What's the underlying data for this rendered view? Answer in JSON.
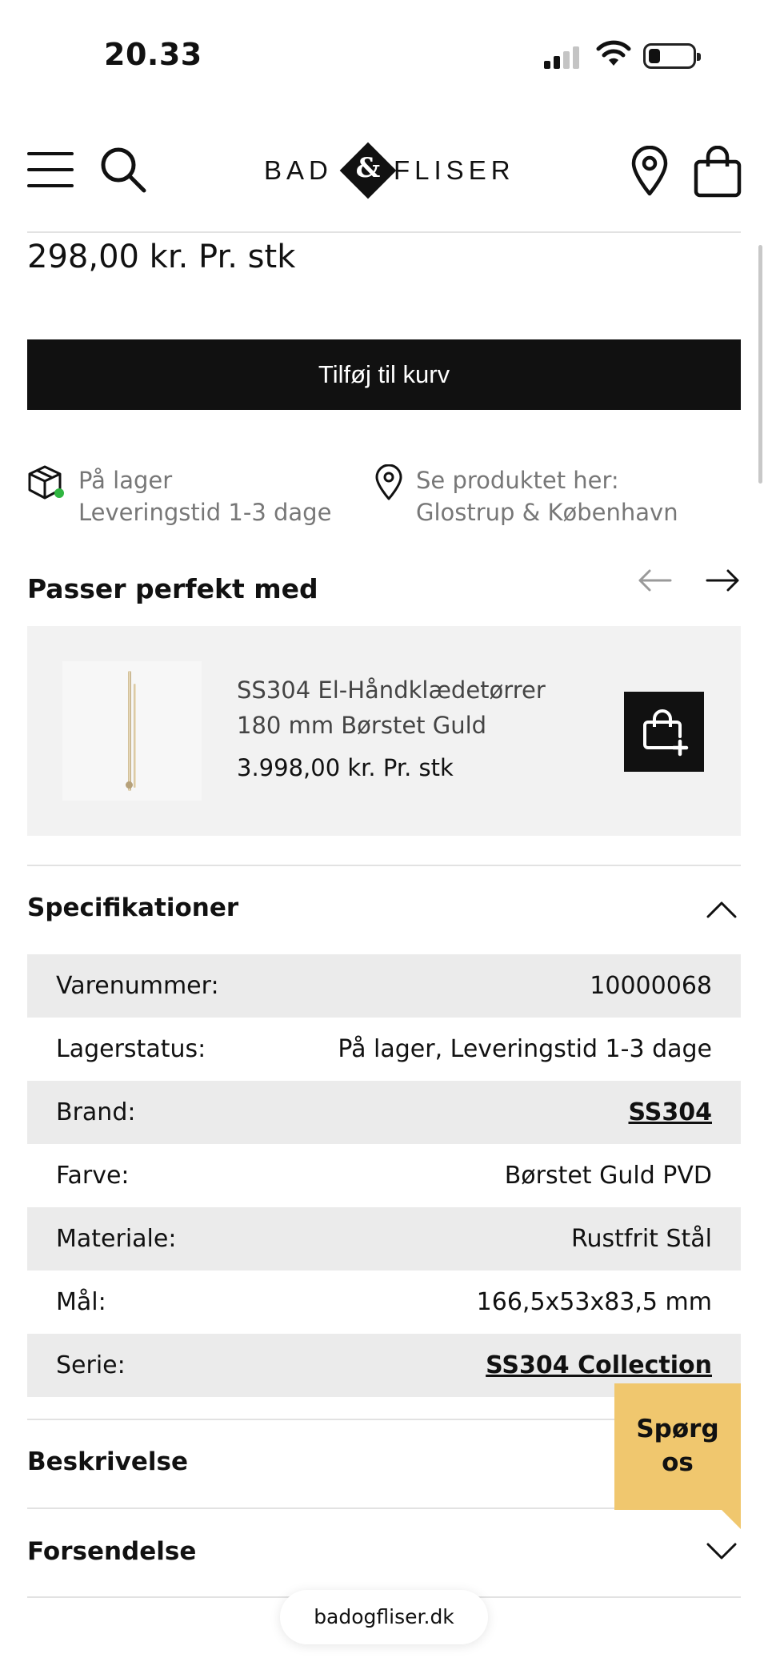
{
  "status_bar": {
    "time": "20.33"
  },
  "header": {
    "logo_left": "BAD",
    "logo_amp": "&",
    "logo_right": "FLISER"
  },
  "product": {
    "price": "298,00 kr. Pr. stk",
    "add_to_cart_label": "Tilføj til kurv"
  },
  "info": {
    "stock_line1": "På lager",
    "stock_line2": "Leveringstid 1-3 dage",
    "location_line1": "Se produktet her:",
    "location_line2": "Glostrup & København",
    "stock_dot_color": "#2fb540"
  },
  "recommendations": {
    "title": "Passer perfekt med",
    "items": [
      {
        "name_line1": "SS304 El-Håndklædetørrer",
        "name_line2": "180 mm Børstet Guld",
        "price": "3.998,00 kr. Pr. stk"
      }
    ]
  },
  "specs": {
    "title": "Specifikationer",
    "rows": [
      {
        "label": "Varenummer:",
        "value": "10000068"
      },
      {
        "label": "Lagerstatus:",
        "value": "På lager, Leveringstid 1-3 dage"
      },
      {
        "label": "Brand:",
        "value": "SS304"
      },
      {
        "label": "Farve:",
        "value": "Børstet Guld PVD"
      },
      {
        "label": "Materiale:",
        "value": "Rustfrit Stål"
      },
      {
        "label": "Mål:",
        "value": "166,5x53x83,5 mm"
      },
      {
        "label": "Serie:",
        "value": "SS304 Collection"
      }
    ]
  },
  "sections": {
    "description": "Beskrivelse",
    "shipping": "Forsendelse"
  },
  "chat": {
    "line1": "Spørg",
    "line2": "os",
    "color": "#f0c76e"
  },
  "browser": {
    "url": "badogfliser.dk"
  }
}
